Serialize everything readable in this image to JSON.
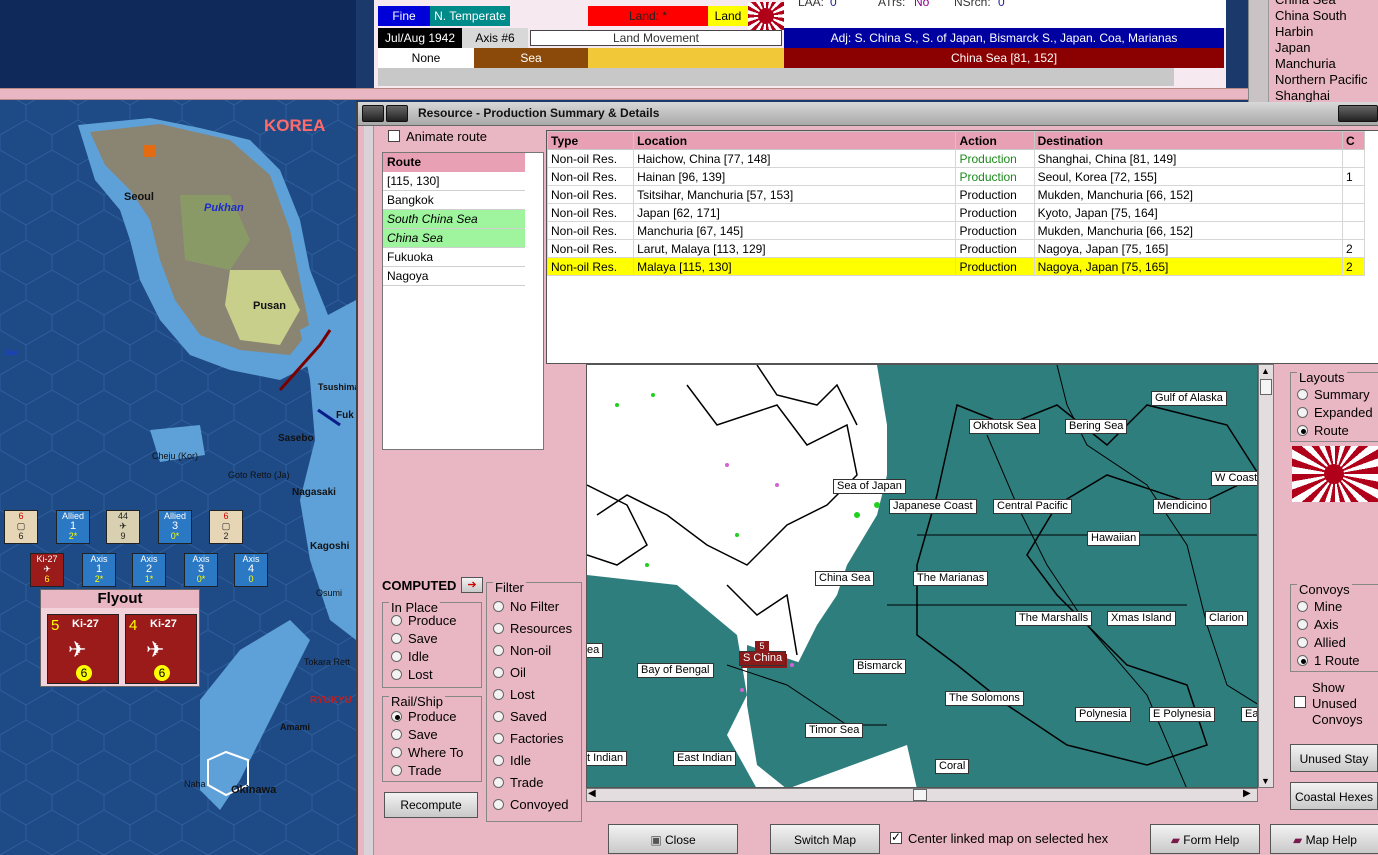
{
  "status": {
    "weather": "Fine",
    "climate": "N. Temperate",
    "terrain_land": "Land: *",
    "land": "Land",
    "date": "Jul/Aug 1942",
    "axis_turn": "Axis #6",
    "phase": "Land Movement",
    "none": "None",
    "sea": "Sea",
    "adjacent": "Adj: S. China S., S. of Japan, Bismarck S., Japan. Coa, Marianas",
    "sea_area": "China Sea [81, 152]",
    "laa_label": "LAA:",
    "laa_val": "0",
    "atrs_label": "ATrs:",
    "atrs_val": "No",
    "nsrch_label": "NSrch:",
    "nsrch_val": "0"
  },
  "regions": [
    "China Sea",
    "China South",
    "Harbin",
    "Japan",
    "Manchuria",
    "Northern Pacific",
    "Shanghai"
  ],
  "dialog": {
    "title": "Resource - Production Summary & Details",
    "animate_route": "Animate route",
    "route_header": "Route",
    "route": [
      {
        "text": "[115, 130]",
        "sel": false
      },
      {
        "text": "Bangkok",
        "sel": false
      },
      {
        "text": "South China Sea",
        "sel": true
      },
      {
        "text": "China Sea",
        "sel": true
      },
      {
        "text": "Fukuoka",
        "sel": false
      },
      {
        "text": "Nagoya",
        "sel": false
      }
    ],
    "columns": [
      "Type",
      "Location",
      "Action",
      "Destination",
      "C"
    ],
    "rows": [
      {
        "type": "Non-oil Res.",
        "location": "Haichow, China [77, 148]",
        "action": "Production",
        "destination": "Shanghai, China [81, 149]",
        "c": "",
        "green": true,
        "hl": false
      },
      {
        "type": "Non-oil Res.",
        "location": "Hainan [96, 139]",
        "action": "Production",
        "destination": "Seoul, Korea [72, 155]",
        "c": "1",
        "green": true,
        "hl": false
      },
      {
        "type": "Non-oil Res.",
        "location": "Tsitsihar, Manchuria [57, 153]",
        "action": "Production",
        "destination": "Mukden, Manchuria [66, 152]",
        "c": "",
        "green": false,
        "hl": false
      },
      {
        "type": "Non-oil Res.",
        "location": "Japan [62, 171]",
        "action": "Production",
        "destination": "Kyoto, Japan [75, 164]",
        "c": "",
        "green": false,
        "hl": false
      },
      {
        "type": "Non-oil Res.",
        "location": "Manchuria [67, 145]",
        "action": "Production",
        "destination": "Mukden, Manchuria [66, 152]",
        "c": "",
        "green": false,
        "hl": false
      },
      {
        "type": "Non-oil Res.",
        "location": "Larut, Malaya [113, 129]",
        "action": "Production",
        "destination": "Nagoya, Japan [75, 165]",
        "c": "2",
        "green": false,
        "hl": false
      },
      {
        "type": "Non-oil Res.",
        "location": "Malaya [115, 130]",
        "action": "Production",
        "destination": "Nagoya, Japan [75, 165]",
        "c": "2",
        "green": false,
        "hl": true
      }
    ],
    "computed": "COMPUTED",
    "in_place": {
      "title": "In Place",
      "options": [
        "Produce",
        "Save",
        "Idle",
        "Lost"
      ]
    },
    "rail_ship": {
      "title": "Rail/Ship",
      "options": [
        "Produce",
        "Save",
        "Where To",
        "Trade"
      ],
      "selected": 0
    },
    "recompute": "Recompute",
    "filter": {
      "title": "Filter",
      "options": [
        "No Filter",
        "Resources",
        "Non-oil",
        "Oil",
        "Lost",
        "Saved",
        "Factories",
        "Idle",
        "Trade",
        "Convoyed"
      ]
    },
    "layouts": {
      "title": "Layouts",
      "options": [
        "Summary",
        "Expanded",
        "Route"
      ],
      "selected": 2
    },
    "convoys": {
      "title": "Convoys",
      "options": [
        "Mine",
        "Axis",
        "Allied",
        "1 Route"
      ],
      "selected": 3
    },
    "show_unused": "Show Unused Convoys",
    "unused_stay": "Unused Stay",
    "coastal_hexes": "Coastal Hexes",
    "close": "Close",
    "switch_map": "Switch Map",
    "center_linked": "Center linked map on selected hex",
    "form_help": "Form Help",
    "map_help": "Map Help"
  },
  "sea_labels": [
    {
      "t": "Gulf of Alaska"
    },
    {
      "t": "Okhotsk Sea"
    },
    {
      "t": "Bering Sea"
    },
    {
      "t": "Sea of Japan"
    },
    {
      "t": "Japanese Coast"
    },
    {
      "t": "Central Pacific"
    },
    {
      "t": "Mendicino"
    },
    {
      "t": "W Coast"
    },
    {
      "t": "Hawaiian"
    },
    {
      "t": "China Sea"
    },
    {
      "t": "The Marianas"
    },
    {
      "t": "The Marshalls"
    },
    {
      "t": "Xmas Island"
    },
    {
      "t": "Clarion"
    },
    {
      "t": "S China"
    },
    {
      "t": "Bay of Bengal"
    },
    {
      "t": "Bismarck"
    },
    {
      "t": "The Solomons"
    },
    {
      "t": "Polynesia"
    },
    {
      "t": "E Polynesia"
    },
    {
      "t": "Timor Sea"
    },
    {
      "t": "East Indian"
    },
    {
      "t": "t Indian"
    },
    {
      "t": "Coral"
    },
    {
      "t": "ea"
    },
    {
      "t": "Easte"
    }
  ],
  "left_map": {
    "places": [
      "KOREA",
      "Seoul",
      "Pukhan",
      "Pusan",
      "Sea",
      "Tsushima",
      "Fuk",
      "Sasebo",
      "Cheju (Kor)",
      "Goto Retto (Ja)",
      "Nagasaki",
      "Kagoshi",
      "Osumi",
      "Tokara Rett",
      "RYUKYU",
      "Amami",
      "Naha",
      "Okinawa"
    ],
    "flyout_title": "Flyout",
    "units": [
      {
        "top": "Allied",
        "mid": "1",
        "bot": "2*"
      },
      {
        "top": "Allied",
        "mid": "3",
        "bot": "0*"
      },
      {
        "top": "Axis",
        "mid": "1",
        "bot": "2*"
      },
      {
        "top": "Axis",
        "mid": "2",
        "bot": "1*"
      },
      {
        "top": "Axis",
        "mid": "3",
        "bot": "0*"
      },
      {
        "top": "Axis",
        "mid": "4",
        "bot": "0"
      }
    ],
    "fly_units": [
      {
        "name": "Ki-27",
        "left": "5",
        "bot": "6"
      },
      {
        "name": "Ki-27",
        "left": "4",
        "bot": "6"
      }
    ]
  },
  "colors": {
    "pink": "#e9b7c3",
    "header_pink": "#e8a0b4",
    "sea_teal": "#2f7e7e",
    "highlight": "#ffff00",
    "status_blue": "#0000c8",
    "status_red": "#8b0000"
  }
}
